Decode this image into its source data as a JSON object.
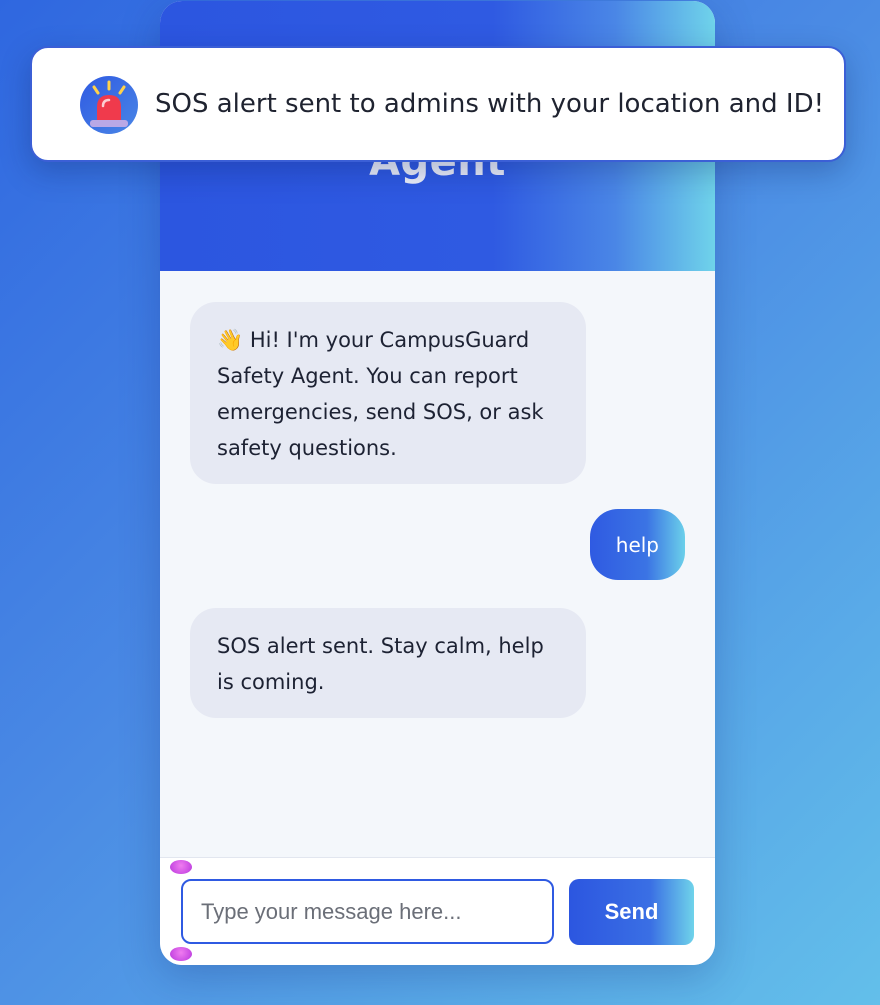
{
  "header": {
    "title": "Agent"
  },
  "toast": {
    "icon": "siren-icon",
    "message": "SOS alert sent to admins with your location and ID!"
  },
  "messages": [
    {
      "sender": "bot",
      "text": "👋 Hi! I'm your CampusGuard Safety Agent. You can report emergencies, send SOS, or ask safety questions."
    },
    {
      "sender": "user",
      "text": "help"
    },
    {
      "sender": "bot",
      "text": "SOS alert sent. Stay calm, help is coming."
    }
  ],
  "composer": {
    "placeholder": "Type your message here...",
    "value": "",
    "send_label": "Send"
  },
  "colors": {
    "accent": "#2f5ae2",
    "accent_light": "#6fd3ea",
    "bot_bubble": "#e6e9f3",
    "alert_red": "#f03a4c"
  }
}
